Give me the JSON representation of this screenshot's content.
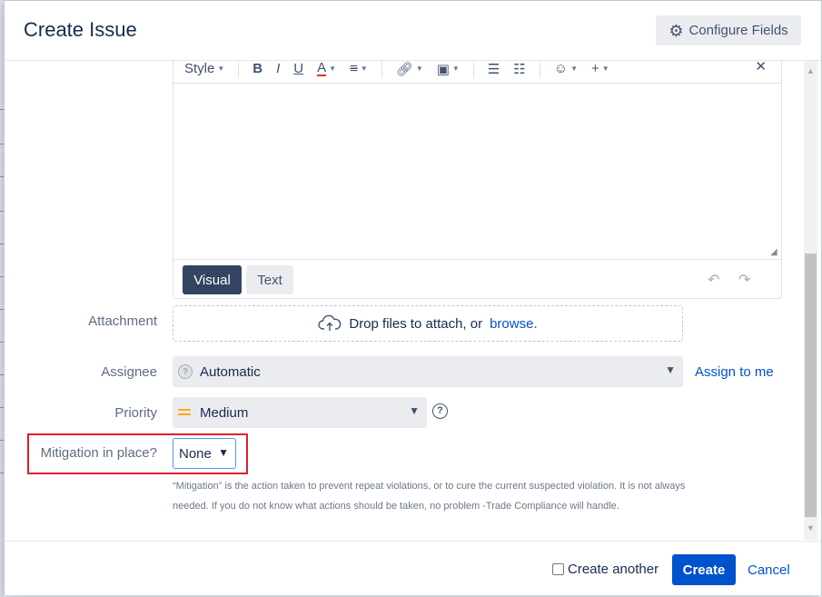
{
  "dialog": {
    "title": "Create Issue",
    "configure_fields_label": "Configure Fields"
  },
  "editor": {
    "toolbar": {
      "style_label": "Style",
      "bold": "B",
      "italic": "I",
      "underline": "U",
      "text_color": "A"
    },
    "tabs": [
      {
        "label": "Visual",
        "active": true
      },
      {
        "label": "Text",
        "active": false
      }
    ]
  },
  "attachment": {
    "label": "Attachment",
    "drop_text": "Drop files to attach, or",
    "browse_link": "browse."
  },
  "assignee": {
    "label": "Assignee",
    "value": "Automatic",
    "assign_to_me": "Assign to me"
  },
  "priority": {
    "label": "Priority",
    "value": "Medium",
    "icon_color": "#ffab00"
  },
  "mitigation": {
    "label": "Mitigation in place?",
    "value": "None",
    "help_text_1": "“Mitigation” is the action taken to prevent repeat violations, or to cure the current suspected violation. It is not always",
    "help_text_2": "needed. If you do not know what actions should be taken, no problem -Trade Compliance will handle.",
    "highlight_color": "#e01e2c"
  },
  "footer": {
    "create_another_label": "Create another",
    "create_another_checked": false,
    "create_label": "Create",
    "cancel_label": "Cancel"
  },
  "colors": {
    "primary": "#0052cc",
    "tab_active": "#344563",
    "field_bg": "#ebecf0"
  }
}
